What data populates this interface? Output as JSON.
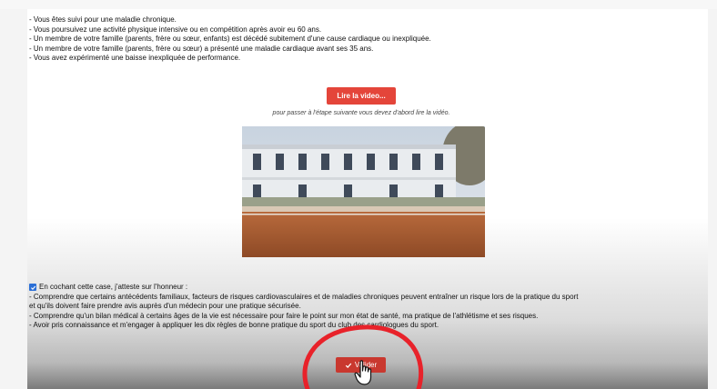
{
  "requirements": [
    "- Vous êtes suivi pour une maladie chronique.",
    "- Vous poursuivez une activité physique intensive ou en compétition après avoir eu 60 ans.",
    "- Un membre de votre famille (parents, frère ou sœur, enfants) est décédé subitement d'une cause cardiaque ou inexpliquée.",
    "- Un membre de votre famille (parents, frère ou sœur) a présenté une maladie cardiaque avant ses 35 ans.",
    "- Vous avez expérimenté une baisse inexpliquée de performance."
  ],
  "video": {
    "button_label": "Lire la video...",
    "hint": "pour passer à l'étape suivante vous devez d'abord lire la vidéo."
  },
  "consent": {
    "checked": true,
    "heading": "En cochant cette case, j'atteste sur l'honneur :",
    "lines": [
      "- Comprendre que certains antécédents familiaux, facteurs de risques cardiovasculaires et de maladies chroniques peuvent entraîner un risque lors de la pratique du sport",
      "et qu'ils doivent faire prendre avis auprès d'un médecin pour une pratique sécurisée.",
      "- Comprendre qu'un bilan médical à certains âges de la vie est nécessaire pour faire le point sur mon état de santé, ma pratique de l'athlétisme et ses risques.",
      "- Avoir pris connaissance et m'engager à appliquer les dix règles de bonne pratique du sport du club des cardiologues du sport."
    ]
  },
  "submit": {
    "icon": "check-icon",
    "label": "Valider"
  },
  "colors": {
    "video_button": "#e4453a",
    "submit_button": "#c9382f",
    "checkbox": "#2b6fd6",
    "annotation_circle": "#e8222a"
  }
}
